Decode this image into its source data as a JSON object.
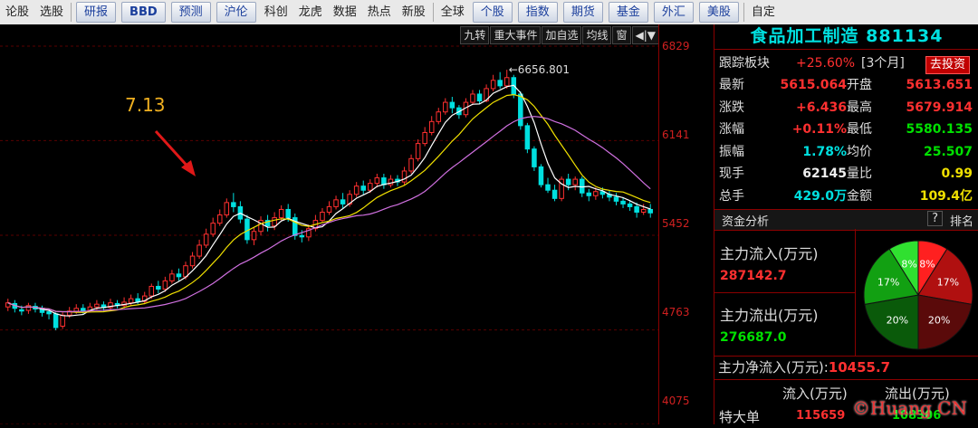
{
  "toolbar": {
    "items": [
      "论股",
      "选股",
      "研报",
      "BBD",
      "预测",
      "沪伦",
      "科创",
      "龙虎",
      "数据",
      "热点",
      "新股",
      "全球",
      "个股",
      "指数",
      "期货",
      "基金",
      "外汇",
      "美股",
      "自定"
    ],
    "highlighted": [
      2,
      3,
      4,
      5,
      12,
      13,
      14,
      15,
      16,
      17
    ]
  },
  "chart_tools": {
    "jiuzhuan": "九转",
    "events": "重大事件",
    "add_watch": "加自选",
    "ma": "均线",
    "window": "窗",
    "arrows": "◀|▼"
  },
  "annotation": {
    "price_note": "7.13",
    "peak_label": "←6656.801"
  },
  "axis": {
    "labels": [
      "6829",
      "6141",
      "5452",
      "4763",
      "4075"
    ]
  },
  "colors": {
    "up": "#ff3030",
    "down": "#00e0e0",
    "ma5": "#ffffff",
    "ma10": "#f0e000",
    "ma20": "#d070e0",
    "accent": "#00e0e0"
  },
  "chart_data": {
    "type": "candlestick",
    "ylim": [
      4075,
      6829
    ],
    "peak": 6656.801,
    "candles": [
      [
        4930,
        4960,
        4990,
        4900
      ],
      [
        4955,
        4920,
        4980,
        4890
      ],
      [
        4910,
        4900,
        4940,
        4870
      ],
      [
        4905,
        4940,
        4960,
        4880
      ],
      [
        4935,
        4915,
        4960,
        4890
      ],
      [
        4920,
        4890,
        4940,
        4860
      ],
      [
        4895,
        4880,
        4920,
        4840
      ],
      [
        4880,
        4780,
        4890,
        4760
      ],
      [
        4790,
        4870,
        4890,
        4770
      ],
      [
        4870,
        4900,
        4930,
        4850
      ],
      [
        4895,
        4920,
        4950,
        4880
      ],
      [
        4920,
        4905,
        4950,
        4880
      ],
      [
        4905,
        4930,
        4960,
        4890
      ],
      [
        4930,
        4950,
        4980,
        4910
      ],
      [
        4945,
        4925,
        4970,
        4900
      ],
      [
        4925,
        4960,
        4990,
        4910
      ],
      [
        4955,
        4940,
        4980,
        4920
      ],
      [
        4940,
        4965,
        5000,
        4920
      ],
      [
        4960,
        4990,
        5020,
        4940
      ],
      [
        4990,
        4970,
        5030,
        4950
      ],
      [
        4970,
        5010,
        5040,
        4950
      ],
      [
        5010,
        5080,
        5100,
        4990
      ],
      [
        5080,
        5060,
        5120,
        5030
      ],
      [
        5060,
        5120,
        5150,
        5040
      ],
      [
        5120,
        5170,
        5200,
        5100
      ],
      [
        5170,
        5150,
        5210,
        5120
      ],
      [
        5150,
        5230,
        5260,
        5130
      ],
      [
        5230,
        5300,
        5330,
        5210
      ],
      [
        5300,
        5380,
        5420,
        5280
      ],
      [
        5380,
        5460,
        5500,
        5360
      ],
      [
        5460,
        5540,
        5580,
        5440
      ],
      [
        5540,
        5600,
        5640,
        5520
      ],
      [
        5600,
        5690,
        5720,
        5580
      ],
      [
        5690,
        5660,
        5760,
        5620
      ],
      [
        5660,
        5570,
        5700,
        5540
      ],
      [
        5570,
        5420,
        5600,
        5390
      ],
      [
        5420,
        5480,
        5510,
        5380
      ],
      [
        5480,
        5560,
        5590,
        5450
      ],
      [
        5560,
        5520,
        5600,
        5480
      ],
      [
        5520,
        5580,
        5620,
        5490
      ],
      [
        5580,
        5640,
        5670,
        5560
      ],
      [
        5640,
        5580,
        5680,
        5550
      ],
      [
        5580,
        5450,
        5610,
        5420
      ],
      [
        5450,
        5440,
        5490,
        5400
      ],
      [
        5440,
        5500,
        5530,
        5410
      ],
      [
        5500,
        5560,
        5600,
        5480
      ],
      [
        5560,
        5620,
        5650,
        5540
      ],
      [
        5620,
        5660,
        5700,
        5600
      ],
      [
        5660,
        5710,
        5740,
        5640
      ],
      [
        5710,
        5680,
        5760,
        5650
      ],
      [
        5680,
        5750,
        5780,
        5660
      ],
      [
        5750,
        5810,
        5840,
        5730
      ],
      [
        5810,
        5780,
        5850,
        5750
      ],
      [
        5780,
        5830,
        5860,
        5760
      ],
      [
        5830,
        5870,
        5900,
        5800
      ],
      [
        5870,
        5820,
        5900,
        5790
      ],
      [
        5820,
        5860,
        5890,
        5800
      ],
      [
        5860,
        5840,
        5890,
        5810
      ],
      [
        5840,
        5920,
        5950,
        5820
      ],
      [
        5920,
        6010,
        6040,
        5900
      ],
      [
        6010,
        6120,
        6150,
        5990
      ],
      [
        6120,
        6200,
        6240,
        6100
      ],
      [
        6200,
        6280,
        6320,
        6180
      ],
      [
        6280,
        6350,
        6380,
        6260
      ],
      [
        6350,
        6420,
        6450,
        6330
      ],
      [
        6420,
        6380,
        6460,
        6340
      ],
      [
        6380,
        6330,
        6400,
        6300
      ],
      [
        6330,
        6420,
        6450,
        6310
      ],
      [
        6420,
        6480,
        6510,
        6400
      ],
      [
        6480,
        6430,
        6510,
        6410
      ],
      [
        6430,
        6520,
        6550,
        6420
      ],
      [
        6520,
        6580,
        6620,
        6500
      ],
      [
        6580,
        6540,
        6640,
        6520
      ],
      [
        6540,
        6600,
        6657,
        6520
      ],
      [
        6600,
        6480,
        6620,
        6450
      ],
      [
        6480,
        6250,
        6500,
        6220
      ],
      [
        6250,
        6080,
        6270,
        6050
      ],
      [
        6080,
        5950,
        6100,
        5920
      ],
      [
        5950,
        5820,
        5970,
        5800
      ],
      [
        5820,
        5780,
        5870,
        5760
      ],
      [
        5780,
        5720,
        5820,
        5700
      ],
      [
        5720,
        5860,
        5880,
        5700
      ],
      [
        5860,
        5820,
        5900,
        5780
      ],
      [
        5820,
        5860,
        5880,
        5780
      ],
      [
        5860,
        5760,
        5880,
        5730
      ],
      [
        5760,
        5740,
        5790,
        5700
      ],
      [
        5740,
        5770,
        5800,
        5710
      ],
      [
        5770,
        5750,
        5800,
        5720
      ],
      [
        5750,
        5730,
        5780,
        5700
      ],
      [
        5730,
        5700,
        5760,
        5670
      ],
      [
        5700,
        5680,
        5730,
        5650
      ],
      [
        5680,
        5660,
        5700,
        5630
      ],
      [
        5660,
        5620,
        5690,
        5580
      ],
      [
        5620,
        5640,
        5680,
        5600
      ],
      [
        5640,
        5615,
        5680,
        5580
      ]
    ]
  },
  "panel": {
    "title": "食品加工制造 881134",
    "track": {
      "label": "跟踪板块",
      "value": "+25.60%",
      "period": "[3个月]",
      "invest": "去投资"
    },
    "stats": [
      {
        "k1": "最新",
        "v1": "5615.064",
        "c1": "red",
        "k2": "开盘",
        "v2": "5613.651",
        "c2": "red"
      },
      {
        "k1": "涨跌",
        "v1": "+6.436",
        "c1": "red",
        "k2": "最高",
        "v2": "5679.914",
        "c2": "red"
      },
      {
        "k1": "涨幅",
        "v1": "+0.11%",
        "c1": "red",
        "k2": "最低",
        "v2": "5580.135",
        "c2": "green"
      },
      {
        "k1": "振幅",
        "v1": "1.78%",
        "c1": "cyan",
        "k2": "均价",
        "v2": "25.507",
        "c2": "green"
      },
      {
        "k1": "现手",
        "v1": "62145",
        "c1": "white",
        "k2": "量比",
        "v2": "0.99",
        "c2": "yellow"
      },
      {
        "k1": "总手",
        "v1": "429.0万",
        "c1": "cyan",
        "k2": "金额",
        "v2": "109.4亿",
        "c2": "yellow"
      }
    ],
    "fund": {
      "header": "资金分析",
      "help": "?",
      "rank": "排名",
      "inflow_label": "主力流入(万元)",
      "inflow_value": "287142.7",
      "outflow_label": "主力流出(万元)",
      "outflow_value": "276687.0",
      "net_label": "主力净流入(万元):",
      "net_value": "10455.7",
      "col_in": "流入(万元)",
      "col_out": "流出(万元)",
      "row_label": "特大单",
      "row_in": "115659",
      "row_out": "108306"
    },
    "pie": [
      {
        "label": "8%",
        "value": 8,
        "color": "#ff2020"
      },
      {
        "label": "17%",
        "value": 17,
        "color": "#b01010"
      },
      {
        "label": "20%",
        "value": 20,
        "color": "#5a0a0a"
      },
      {
        "label": "20%",
        "value": 20,
        "color": "#0a5a0a"
      },
      {
        "label": "17%",
        "value": 17,
        "color": "#12a012"
      },
      {
        "label": "8%",
        "value": 8,
        "color": "#30e030"
      }
    ]
  },
  "watermark": "©Huang CN"
}
